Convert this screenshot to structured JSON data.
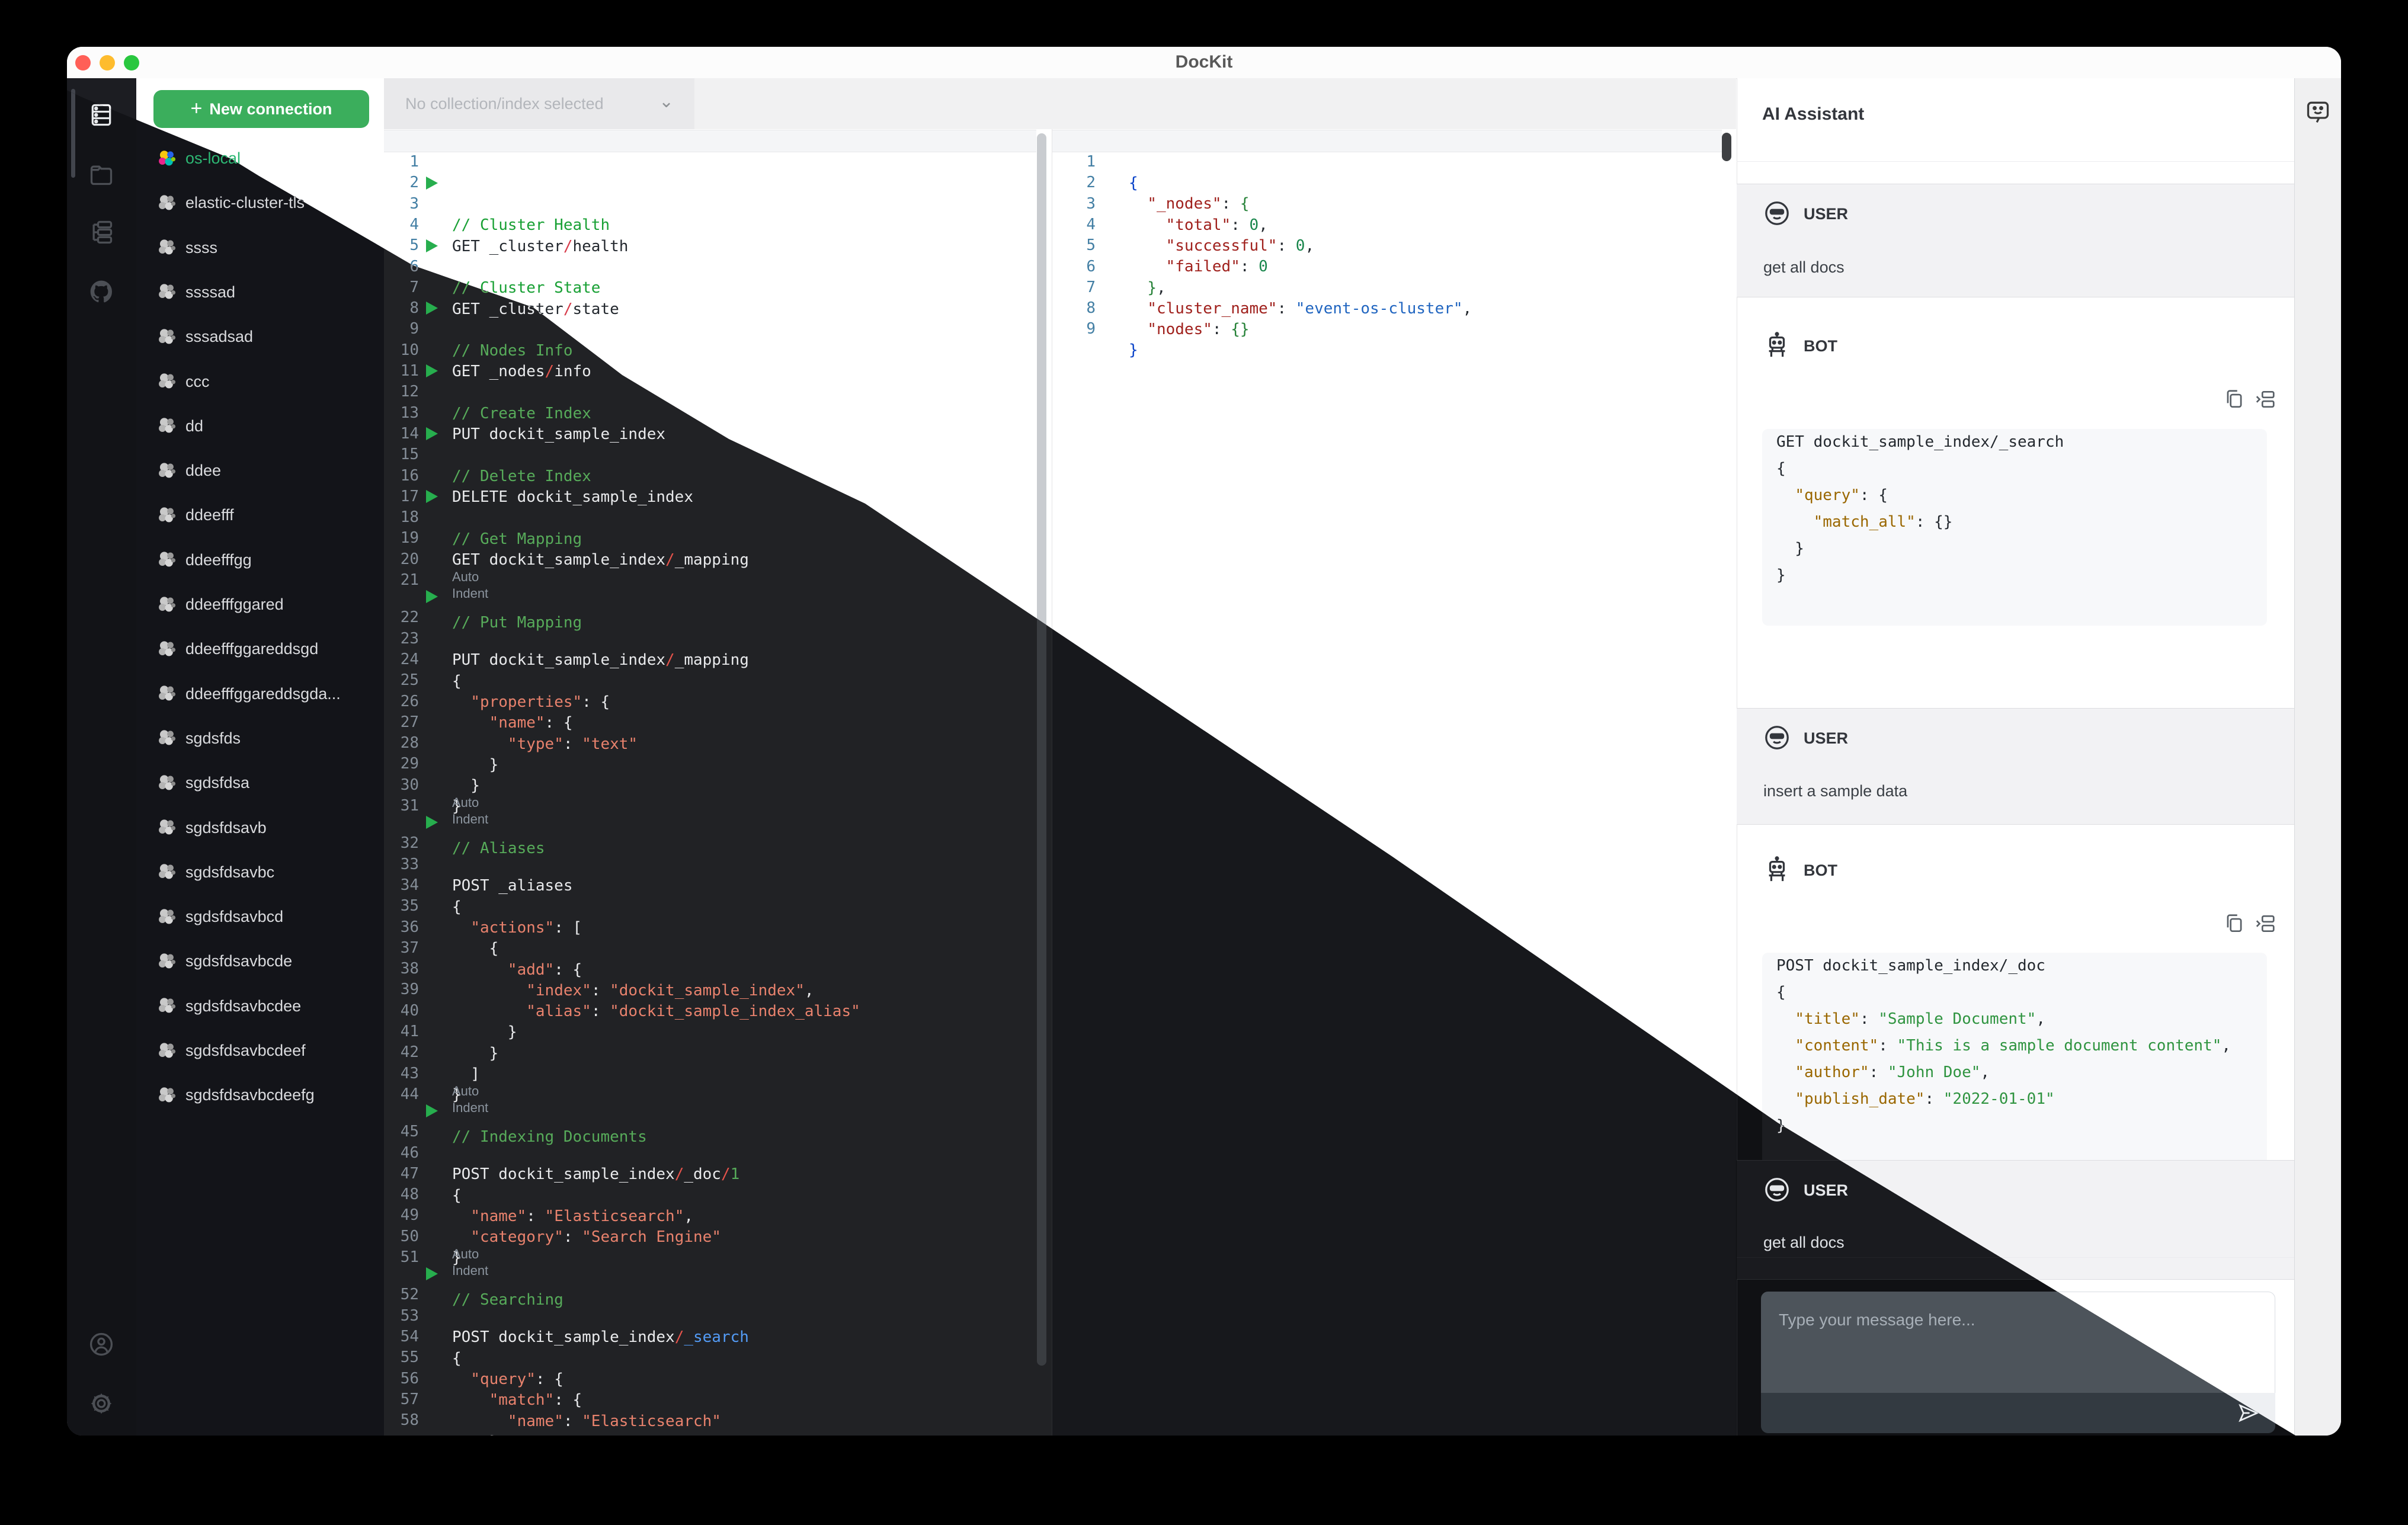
{
  "window": {
    "title": "DocKit"
  },
  "rail": {
    "icons": [
      "collections-icon",
      "folder-icon",
      "tree-icon",
      "github-icon"
    ],
    "bottom_icons": [
      "account-icon",
      "settings-icon"
    ]
  },
  "connections": {
    "new_button": "New connection",
    "items": [
      {
        "label": "os-local",
        "active": true
      },
      {
        "label": "elastic-cluster-tls",
        "active": false
      },
      {
        "label": "ssss",
        "active": false
      },
      {
        "label": "ssssad",
        "active": false
      },
      {
        "label": "sssadsad",
        "active": false
      },
      {
        "label": "ccc",
        "active": false
      },
      {
        "label": "dd",
        "active": false
      },
      {
        "label": "ddee",
        "active": false
      },
      {
        "label": "ddeefff",
        "active": false
      },
      {
        "label": "ddeefffgg",
        "active": false
      },
      {
        "label": "ddeefffggared",
        "active": false
      },
      {
        "label": "ddeefffggareddsgd",
        "active": false
      },
      {
        "label": "ddeefffggareddsgda...",
        "active": false
      },
      {
        "label": "sgdsfds",
        "active": false
      },
      {
        "label": "sgdsfdsa",
        "active": false
      },
      {
        "label": "sgdsfdsavb",
        "active": false
      },
      {
        "label": "sgdsfdsavbc",
        "active": false
      },
      {
        "label": "sgdsfdsavbcd",
        "active": false
      },
      {
        "label": "sgdsfdsavbcde",
        "active": false
      },
      {
        "label": "sgdsfdsavbcdee",
        "active": false
      },
      {
        "label": "sgdsfdsavbcdeef",
        "active": false
      },
      {
        "label": "sgdsfdsavbcdeefg",
        "active": false
      }
    ]
  },
  "toolbar": {
    "collection_placeholder": "No collection/index selected"
  },
  "editor": {
    "auto_indent_label": "Auto Indent",
    "lines": [
      {
        "n": 1,
        "p": []
      },
      {
        "n": 2,
        "p": [
          [
            "c",
            "// Cluster Health"
          ]
        ]
      },
      {
        "n": 3,
        "run": true,
        "p": [
          [
            "m",
            "GET _cluster"
          ],
          [
            "s",
            "/"
          ],
          [
            "m",
            "health"
          ]
        ]
      },
      {
        "n": 4,
        "p": []
      },
      {
        "n": 5,
        "p": [
          [
            "c",
            "// Cluster State"
          ]
        ]
      },
      {
        "n": 6,
        "run": true,
        "p": [
          [
            "m",
            "GET _cluster"
          ],
          [
            "s",
            "/"
          ],
          [
            "m",
            "state"
          ]
        ]
      },
      {
        "n": 7,
        "p": []
      },
      {
        "n": 8,
        "p": [
          [
            "c",
            "// Nodes Info"
          ]
        ]
      },
      {
        "n": 9,
        "run": true,
        "p": [
          [
            "m",
            "GET _nodes"
          ],
          [
            "s",
            "/"
          ],
          [
            "m",
            "info"
          ]
        ]
      },
      {
        "n": 10,
        "p": []
      },
      {
        "n": 11,
        "p": [
          [
            "c",
            "// Create Index"
          ]
        ]
      },
      {
        "n": 12,
        "run": true,
        "p": [
          [
            "m",
            "PUT dockit_sample_index"
          ]
        ]
      },
      {
        "n": 13,
        "p": []
      },
      {
        "n": 14,
        "p": [
          [
            "c",
            "// Delete Index"
          ]
        ]
      },
      {
        "n": 15,
        "run": true,
        "p": [
          [
            "m",
            "DELETE dockit_sample_index"
          ]
        ]
      },
      {
        "n": 16,
        "p": []
      },
      {
        "n": 17,
        "p": [
          [
            "c",
            "// Get Mapping"
          ]
        ]
      },
      {
        "n": 18,
        "run": true,
        "p": [
          [
            "m",
            "GET dockit_sample_index"
          ],
          [
            "s",
            "/"
          ],
          [
            "m",
            "_mapping"
          ]
        ]
      },
      {
        "n": 19,
        "p": []
      },
      {
        "n": 20,
        "p": []
      },
      {
        "n": 21,
        "p": [
          [
            "c",
            "// Put Mapping"
          ]
        ]
      },
      {
        "hint": true
      },
      {
        "n": 22,
        "run": true,
        "p": [
          [
            "m",
            "PUT dockit_sample_index"
          ],
          [
            "s",
            "/"
          ],
          [
            "m",
            "_mapping"
          ]
        ]
      },
      {
        "n": 23,
        "p": [
          [
            "d",
            "{"
          ]
        ]
      },
      {
        "n": 24,
        "p": [
          [
            "d",
            "  "
          ],
          [
            "k",
            "\"properties\""
          ],
          [
            "d",
            ": {"
          ]
        ]
      },
      {
        "n": 25,
        "p": [
          [
            "d",
            "    "
          ],
          [
            "k",
            "\"name\""
          ],
          [
            "d",
            ": {"
          ]
        ]
      },
      {
        "n": 26,
        "p": [
          [
            "d",
            "      "
          ],
          [
            "k",
            "\"type\""
          ],
          [
            "d",
            ": "
          ],
          [
            "v",
            "\"text\""
          ]
        ]
      },
      {
        "n": 27,
        "p": [
          [
            "d",
            "    }"
          ]
        ]
      },
      {
        "n": 28,
        "p": [
          [
            "d",
            "  }"
          ]
        ]
      },
      {
        "n": 29,
        "p": [
          [
            "d",
            "}"
          ]
        ]
      },
      {
        "n": 30,
        "p": []
      },
      {
        "n": 31,
        "p": [
          [
            "c",
            "// Aliases"
          ]
        ]
      },
      {
        "hint": true
      },
      {
        "n": 32,
        "run": true,
        "p": [
          [
            "m",
            "POST _aliases"
          ]
        ]
      },
      {
        "n": 33,
        "p": [
          [
            "d",
            "{"
          ]
        ]
      },
      {
        "n": 34,
        "p": [
          [
            "d",
            "  "
          ],
          [
            "k",
            "\"actions\""
          ],
          [
            "d",
            ": ["
          ]
        ]
      },
      {
        "n": 35,
        "p": [
          [
            "d",
            "    {"
          ]
        ]
      },
      {
        "n": 36,
        "p": [
          [
            "d",
            "      "
          ],
          [
            "k",
            "\"add\""
          ],
          [
            "d",
            ": {"
          ]
        ]
      },
      {
        "n": 37,
        "p": [
          [
            "d",
            "        "
          ],
          [
            "k",
            "\"index\""
          ],
          [
            "d",
            ": "
          ],
          [
            "v",
            "\"dockit_sample_index\""
          ],
          [
            "d",
            ","
          ]
        ]
      },
      {
        "n": 38,
        "p": [
          [
            "d",
            "        "
          ],
          [
            "k",
            "\"alias\""
          ],
          [
            "d",
            ": "
          ],
          [
            "v",
            "\"dockit_sample_index_alias\""
          ]
        ]
      },
      {
        "n": 39,
        "p": [
          [
            "d",
            "      }"
          ]
        ]
      },
      {
        "n": 40,
        "p": [
          [
            "d",
            "    }"
          ]
        ]
      },
      {
        "n": 41,
        "p": [
          [
            "d",
            "  ]"
          ]
        ]
      },
      {
        "n": 42,
        "p": [
          [
            "d",
            "}"
          ]
        ]
      },
      {
        "n": 43,
        "p": []
      },
      {
        "n": 44,
        "p": [
          [
            "c",
            "// Indexing Documents"
          ]
        ]
      },
      {
        "hint": true
      },
      {
        "n": 45,
        "run": true,
        "p": [
          [
            "m",
            "POST dockit_sample_index"
          ],
          [
            "s",
            "/"
          ],
          [
            "m",
            "_doc"
          ],
          [
            "s",
            "/"
          ],
          [
            "n2",
            "1"
          ]
        ]
      },
      {
        "n": 46,
        "p": [
          [
            "d",
            "{"
          ]
        ]
      },
      {
        "n": 47,
        "p": [
          [
            "d",
            "  "
          ],
          [
            "k",
            "\"name\""
          ],
          [
            "d",
            ": "
          ],
          [
            "v",
            "\"Elasticsearch\""
          ],
          [
            "d",
            ","
          ]
        ]
      },
      {
        "n": 48,
        "p": [
          [
            "d",
            "  "
          ],
          [
            "k",
            "\"category\""
          ],
          [
            "d",
            ": "
          ],
          [
            "v",
            "\"Search Engine\""
          ]
        ]
      },
      {
        "n": 49,
        "p": [
          [
            "d",
            "}"
          ]
        ]
      },
      {
        "n": 50,
        "p": []
      },
      {
        "n": 51,
        "p": [
          [
            "c",
            "// Searching"
          ]
        ]
      },
      {
        "hint": true
      },
      {
        "n": 52,
        "run": true,
        "p": [
          [
            "m",
            "POST dockit_sample_index"
          ],
          [
            "s",
            "/"
          ],
          [
            "b",
            "_search"
          ]
        ]
      },
      {
        "n": 53,
        "p": [
          [
            "d",
            "{"
          ]
        ]
      },
      {
        "n": 54,
        "p": [
          [
            "d",
            "  "
          ],
          [
            "k",
            "\"query\""
          ],
          [
            "d",
            ": {"
          ]
        ]
      },
      {
        "n": 55,
        "p": [
          [
            "d",
            "    "
          ],
          [
            "k",
            "\"match\""
          ],
          [
            "d",
            ": {"
          ]
        ]
      },
      {
        "n": 56,
        "p": [
          [
            "d",
            "      "
          ],
          [
            "k",
            "\"name\""
          ],
          [
            "d",
            ": "
          ],
          [
            "v",
            "\"Elasticsearch\""
          ]
        ]
      },
      {
        "n": 57,
        "p": [
          [
            "d",
            "    }"
          ]
        ]
      },
      {
        "n": 58,
        "p": [
          [
            "d",
            "  }"
          ]
        ]
      }
    ]
  },
  "results": {
    "lines": [
      {
        "n": 1,
        "p": [
          [
            "b",
            "{"
          ]
        ]
      },
      {
        "n": 2,
        "p": [
          [
            "d",
            "  "
          ],
          [
            "k",
            "\"_nodes\""
          ],
          [
            "d",
            ": "
          ],
          [
            "p2",
            "{"
          ]
        ]
      },
      {
        "n": 3,
        "p": [
          [
            "d",
            "    "
          ],
          [
            "k",
            "\"total\""
          ],
          [
            "d",
            ": "
          ],
          [
            "n2",
            "0"
          ],
          [
            "d",
            ","
          ]
        ]
      },
      {
        "n": 4,
        "p": [
          [
            "d",
            "    "
          ],
          [
            "k",
            "\"successful\""
          ],
          [
            "d",
            ": "
          ],
          [
            "n2",
            "0"
          ],
          [
            "d",
            ","
          ]
        ]
      },
      {
        "n": 5,
        "p": [
          [
            "d",
            "    "
          ],
          [
            "k",
            "\"failed\""
          ],
          [
            "d",
            ": "
          ],
          [
            "n2",
            "0"
          ]
        ]
      },
      {
        "n": 6,
        "p": [
          [
            "d",
            "  "
          ],
          [
            "p2",
            "}"
          ],
          [
            "d",
            ","
          ]
        ]
      },
      {
        "n": 7,
        "p": [
          [
            "d",
            "  "
          ],
          [
            "k",
            "\"cluster_name\""
          ],
          [
            "d",
            ": "
          ],
          [
            "v",
            "\"event-os-cluster\""
          ],
          [
            "d",
            ","
          ]
        ]
      },
      {
        "n": 8,
        "p": [
          [
            "d",
            "  "
          ],
          [
            "k",
            "\"nodes\""
          ],
          [
            "d",
            ": "
          ],
          [
            "p2",
            "{}"
          ]
        ]
      },
      {
        "n": 9,
        "p": [
          [
            "b",
            "}"
          ]
        ]
      }
    ]
  },
  "assistant": {
    "title": "AI Assistant",
    "user_label": "USER",
    "bot_label": "BOT",
    "messages": [
      {
        "role": "USER",
        "text": "get all docs"
      },
      {
        "role": "BOT",
        "code": [
          [
            [
              "d",
              "GET dockit_sample_index/_search"
            ]
          ],
          [
            [
              "d",
              "{"
            ]
          ],
          [
            [
              "d",
              "  "
            ],
            [
              "g",
              "\"query\""
            ],
            [
              "d",
              ": {"
            ]
          ],
          [
            [
              "d",
              "    "
            ],
            [
              "g",
              "\"match_all\""
            ],
            [
              "d",
              ": {}"
            ]
          ],
          [
            [
              "d",
              "  }"
            ]
          ],
          [
            [
              "d",
              "}"
            ]
          ]
        ]
      },
      {
        "role": "USER",
        "text": "insert a sample data"
      },
      {
        "role": "BOT",
        "code": [
          [
            [
              "d",
              "POST dockit_sample_index/_doc"
            ]
          ],
          [
            [
              "d",
              "{"
            ]
          ],
          [
            [
              "d",
              "  "
            ],
            [
              "g",
              "\"title\""
            ],
            [
              "d",
              ": "
            ],
            [
              "gr",
              "\"Sample Document\""
            ],
            [
              "d",
              ","
            ]
          ],
          [
            [
              "d",
              "  "
            ],
            [
              "g",
              "\"content\""
            ],
            [
              "d",
              ": "
            ],
            [
              "gr",
              "\"This is a sample document content\""
            ],
            [
              "d",
              ","
            ]
          ],
          [
            [
              "d",
              "  "
            ],
            [
              "g",
              "\"author\""
            ],
            [
              "d",
              ": "
            ],
            [
              "gr",
              "\"John Doe\""
            ],
            [
              "d",
              ","
            ]
          ],
          [
            [
              "d",
              "  "
            ],
            [
              "g",
              "\"publish_date\""
            ],
            [
              "d",
              ": "
            ],
            [
              "gr",
              "\"2022-01-01\""
            ]
          ],
          [
            [
              "d",
              "}"
            ]
          ]
        ]
      },
      {
        "role": "USER",
        "text": "get all docs"
      }
    ],
    "input_placeholder": "Type your message here..."
  },
  "colors": {
    "accent_green": "#3bae5c",
    "active_connection": "#2db874",
    "traffic_red": "#ff5f57",
    "traffic_yellow": "#febc2e",
    "traffic_green": "#29c73f"
  }
}
